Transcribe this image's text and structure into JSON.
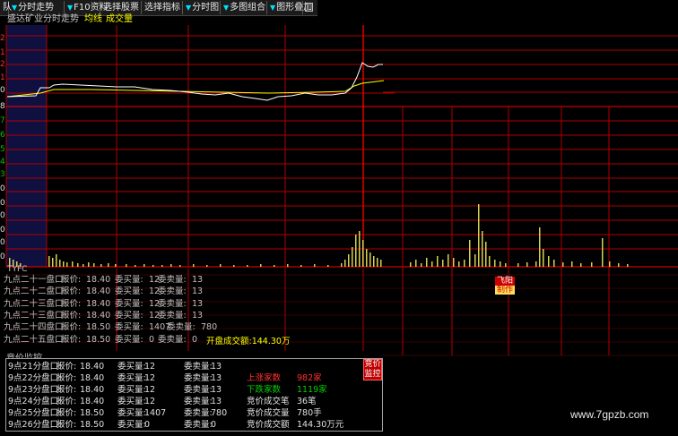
{
  "toolbar": {
    "items": [
      {
        "label": "队"
      },
      {
        "label": "分时走势"
      },
      {
        "label": "F10资料"
      },
      {
        "label": "选择股票"
      },
      {
        "label": "选择指标"
      },
      {
        "label": "分时图"
      },
      {
        "label": "多图组合"
      },
      {
        "label": "图形叠加"
      }
    ]
  },
  "chart": {
    "title": "盛达矿业分时走势",
    "avg_label": "均线",
    "vol_label": "成交量",
    "indicator_label": "TYFC",
    "colors": {
      "price": "#ffffff",
      "avg": "#ffff00",
      "grid": "#b00000",
      "volume": "#d8d050",
      "accent": "#ff0000"
    }
  },
  "orders": [
    {
      "time": "九点二十一盘口:",
      "price_label": "报价:",
      "price": "18.40",
      "buy_label": "委买量:",
      "buy": "12",
      "sell_label": "委卖量:",
      "sell": "13"
    },
    {
      "time": "九点二十二盘口:",
      "price_label": "报价:",
      "price": "18.40",
      "buy_label": "委买量:",
      "buy": "12",
      "sell_label": "委卖量:",
      "sell": "13"
    },
    {
      "time": "九点二十三盘口:",
      "price_label": "报价:",
      "price": "18.40",
      "buy_label": "委买量:",
      "buy": "12",
      "sell_label": "委卖量:",
      "sell": "13"
    },
    {
      "time": "九点二十三盘口:",
      "price_label": "报价:",
      "price": "18.40",
      "buy_label": "委买量:",
      "buy": "12",
      "sell_label": "委卖量:",
      "sell": "13"
    },
    {
      "time": "九点二十四盘口:",
      "price_label": "报价:",
      "price": "18.50",
      "buy_label": "委买量:",
      "buy": "1407",
      "sell_label": "委卖量:",
      "sell": "780"
    },
    {
      "time": "九点二十五盘口:",
      "price_label": "报价:",
      "price": "18.50",
      "buy_label": "委买量:",
      "buy": "0",
      "sell_label": "委卖量:",
      "sell": "0"
    }
  ],
  "open_amount": "开盘成交额:144.30万",
  "tags": {
    "fly": "飞阳",
    "make": "制作"
  },
  "auction": {
    "title": "竞价监控",
    "button": "竞价监控",
    "rows": [
      {
        "time": "9点21分盘口:",
        "price_label": "报价:",
        "price": "18.40",
        "buy_label": "委买量:",
        "buy": "12",
        "sell_label": "委卖量:",
        "sell": "13"
      },
      {
        "time": "9点22分盘口:",
        "price_label": "报价:",
        "price": "18.40",
        "buy_label": "委买量:",
        "buy": "12",
        "sell_label": "委卖量:",
        "sell": "13"
      },
      {
        "time": "9点23分盘口:",
        "price_label": "报价:",
        "price": "18.40",
        "buy_label": "委买量:",
        "buy": "12",
        "sell_label": "委卖量:",
        "sell": "13"
      },
      {
        "time": "9点24分盘口:",
        "price_label": "报价:",
        "price": "18.40",
        "buy_label": "委买量:",
        "buy": "12",
        "sell_label": "委卖量:",
        "sell": "13"
      },
      {
        "time": "9点25分盘口:",
        "price_label": "报价:",
        "price": "18.50",
        "buy_label": "委买量:",
        "buy": "1407",
        "sell_label": "委卖量:",
        "sell": "780"
      },
      {
        "time": "9点26分盘口:",
        "price_label": "报价:",
        "price": "18.50",
        "buy_label": "委买量:",
        "buy": "0",
        "sell_label": "委卖量:",
        "sell": "0"
      }
    ],
    "stats": [
      {
        "label": "上涨家数",
        "value": "982家"
      },
      {
        "label": "下跌家数",
        "value": "1119家"
      },
      {
        "label": "竞价成交笔",
        "value": "36笔"
      },
      {
        "label": "竞价成交量",
        "value": "780手"
      },
      {
        "label": "竞价成交额",
        "value": "144.30万元"
      }
    ]
  },
  "watermark": "www.7gpzb.com"
}
